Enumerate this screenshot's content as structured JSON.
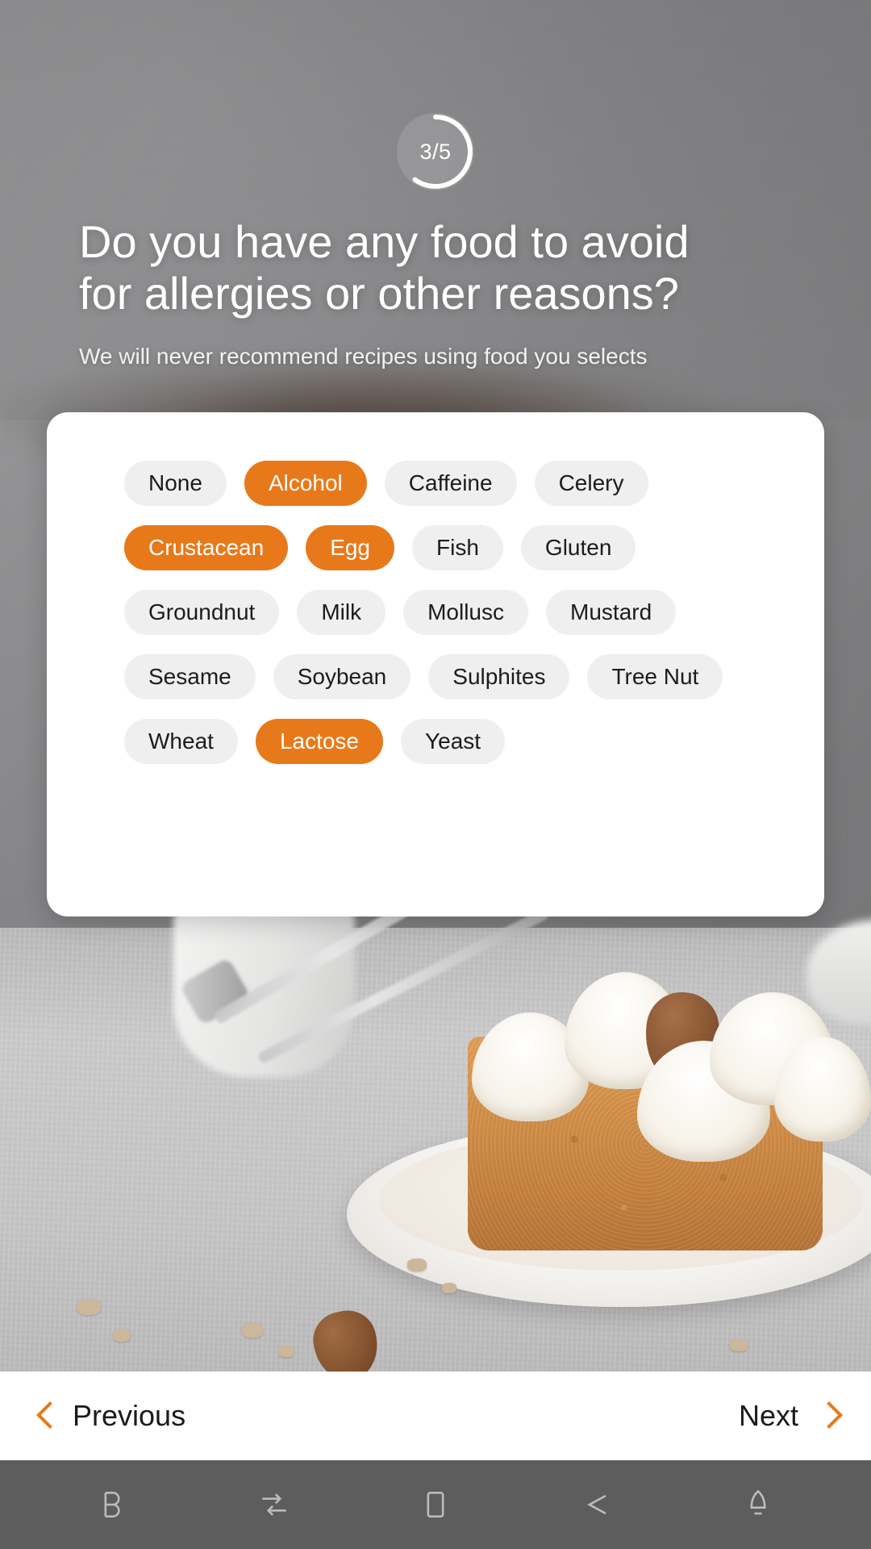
{
  "progress": {
    "label": "3/5",
    "current": 3,
    "total": 5,
    "ring_color": "#ffffff",
    "track_color": "rgba(255,255,255,0.13)"
  },
  "headline": "Do you have any food to avoid for allergies or other reasons?",
  "subtitle": "We will never recommend recipes using food you selects",
  "theme": {
    "accent": "#e8791a",
    "chip_bg": "#efefef",
    "chip_text": "#1c1c1c",
    "card_bg": "#ffffff",
    "sysnav_bg": "#5d5d5d"
  },
  "chips": {
    "rows": [
      [
        {
          "label": "None",
          "selected": false
        },
        {
          "label": "Alcohol",
          "selected": true
        },
        {
          "label": "Caffeine",
          "selected": false
        },
        {
          "label": "Celery",
          "selected": false
        }
      ],
      [
        {
          "label": "Crustacean",
          "selected": true
        },
        {
          "label": "Egg",
          "selected": true
        },
        {
          "label": "Fish",
          "selected": false
        },
        {
          "label": "Gluten",
          "selected": false
        }
      ],
      [
        {
          "label": "Groundnut",
          "selected": false
        },
        {
          "label": "Milk",
          "selected": false
        },
        {
          "label": "Mollusc",
          "selected": false
        },
        {
          "label": "Mustard",
          "selected": false
        }
      ],
      [
        {
          "label": "Sesame",
          "selected": false
        },
        {
          "label": "Soybean",
          "selected": false
        },
        {
          "label": "Sulphites",
          "selected": false
        },
        {
          "label": "Tree Nut",
          "selected": false
        }
      ],
      [
        {
          "label": "Wheat",
          "selected": false
        },
        {
          "label": "Lactose",
          "selected": true
        },
        {
          "label": "Yeast",
          "selected": false
        }
      ]
    ]
  },
  "bottom_nav": {
    "previous_label": "Previous",
    "next_label": "Next",
    "previous_icon": "chevron-left-icon",
    "next_icon": "chevron-right-icon"
  },
  "system_nav": {
    "items": [
      {
        "icon": "bixby-icon"
      },
      {
        "icon": "recents-swap-icon"
      },
      {
        "icon": "screenshot-icon"
      },
      {
        "icon": "back-arrow-icon"
      },
      {
        "icon": "notification-bell-icon"
      }
    ]
  }
}
